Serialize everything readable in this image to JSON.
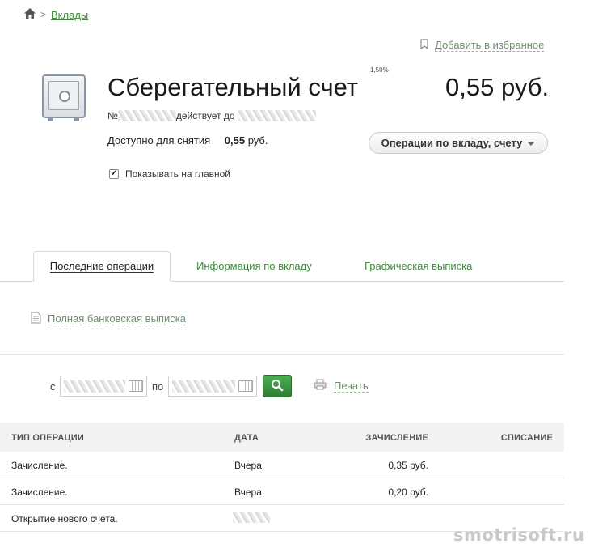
{
  "breadcrumb": {
    "home_icon": "home-icon",
    "separator": ">",
    "link": "Вклады"
  },
  "favorite": {
    "icon": "bookmark-icon",
    "label": "Добавить в избранное"
  },
  "account": {
    "icon": "safe-icon",
    "title": "Сберегательный счет",
    "rate": "1,50%",
    "balance": "0,55 руб.",
    "number_prefix": "№",
    "valid_until": "действует до",
    "available_label": "Доступно для снятия",
    "available_amount": "0,55",
    "available_currency": "руб.",
    "show_on_main_label": "Показывать на главной",
    "show_on_main_checked": true
  },
  "operations_button": {
    "label": "Операции по вкладу, счету"
  },
  "tabs": [
    {
      "label": "Последние операции",
      "active": true
    },
    {
      "label": "Информация по вкладу",
      "active": false
    },
    {
      "label": "Графическая выписка",
      "active": false
    }
  ],
  "statement_link": {
    "icon": "document-icon",
    "label": "Полная банковская выписка"
  },
  "filter": {
    "from_label": "с",
    "to_label": "по",
    "search_icon": "search-icon",
    "print_icon": "printer-icon",
    "print_label": "Печать"
  },
  "table": {
    "headers": {
      "type": "ТИП ОПЕРАЦИИ",
      "date": "ДАТА",
      "credit": "ЗАЧИСЛЕНИЕ",
      "debit": "СПИСАНИЕ"
    },
    "rows": [
      {
        "type": "Зачисление.",
        "date": "Вчера",
        "credit": "0,35 руб.",
        "debit": ""
      },
      {
        "type": "Зачисление.",
        "date": "Вчера",
        "credit": "0,20 руб.",
        "debit": ""
      },
      {
        "type": "Открытие нового счета.",
        "date": "",
        "credit": "",
        "debit": ""
      }
    ]
  },
  "watermark": "smotrisoft.ru",
  "colors": {
    "link_green": "#3d8a3d",
    "button_green": "#2e7d32"
  }
}
